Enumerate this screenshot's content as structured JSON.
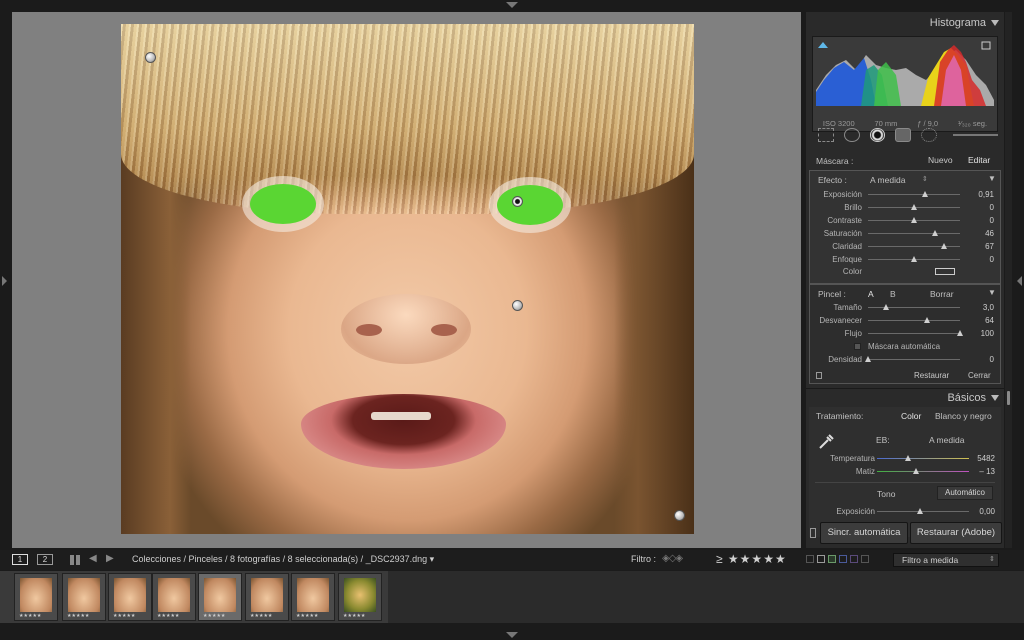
{
  "histogram": {
    "title": "Histograma",
    "iso": "ISO 3200",
    "focal": "70 mm",
    "aperture": "ƒ / 9,0",
    "shutter": "¹⁄₃₂₀ seg."
  },
  "mask": {
    "label": "Máscara :",
    "new": "Nuevo",
    "edit": "Editar"
  },
  "effect": {
    "label": "Efecto :",
    "preset": "A medida",
    "rows": [
      {
        "name": "Exposición",
        "value": "0,91",
        "pos": 0.62
      },
      {
        "name": "Brillo",
        "value": "0",
        "pos": 0.5
      },
      {
        "name": "Contraste",
        "value": "0",
        "pos": 0.5
      },
      {
        "name": "Saturación",
        "value": "46",
        "pos": 0.73
      },
      {
        "name": "Claridad",
        "value": "67",
        "pos": 0.83
      },
      {
        "name": "Enfoque",
        "value": "0",
        "pos": 0.5
      }
    ],
    "color_label": "Color"
  },
  "brush": {
    "label": "Pincel :",
    "a": "A",
    "b": "B",
    "erase": "Borrar",
    "rows": [
      {
        "name": "Tamaño",
        "value": "3,0",
        "pos": 0.2
      },
      {
        "name": "Desvanecer",
        "value": "64",
        "pos": 0.64
      },
      {
        "name": "Flujo",
        "value": "100",
        "pos": 1.0
      }
    ],
    "auto_mask": "Máscara automática",
    "density_name": "Densidad",
    "density_value": "0",
    "restore": "Restaurar",
    "close": "Cerrar"
  },
  "basics": {
    "title": "Básicos",
    "treatment_label": "Tratamiento:",
    "color": "Color",
    "bw": "Blanco y negro",
    "wb_label": "EB:",
    "wb_value": "A medida",
    "temp_name": "Temperatura",
    "temp_value": "5482",
    "tint_name": "Matiz",
    "tint_value": "– 13",
    "tone_label": "Tono",
    "auto": "Automático",
    "exposure_name": "Exposición",
    "exposure_value": "0,00"
  },
  "buttons": {
    "sync": "Sincr. automática",
    "restore": "Restaurar (Adobe)"
  },
  "filmbar": {
    "mon1": "1",
    "mon2": "2",
    "path": "Colecciones / Pinceles / 8 fotografías / 8 seleccionada(s) / _DSC2937.dng ▾",
    "filter_label": "Filtro :",
    "stars": "≥ ★★★★★",
    "filter_select": "Filtro a medida"
  },
  "film": {
    "thumb_stars": "★★★★★"
  }
}
